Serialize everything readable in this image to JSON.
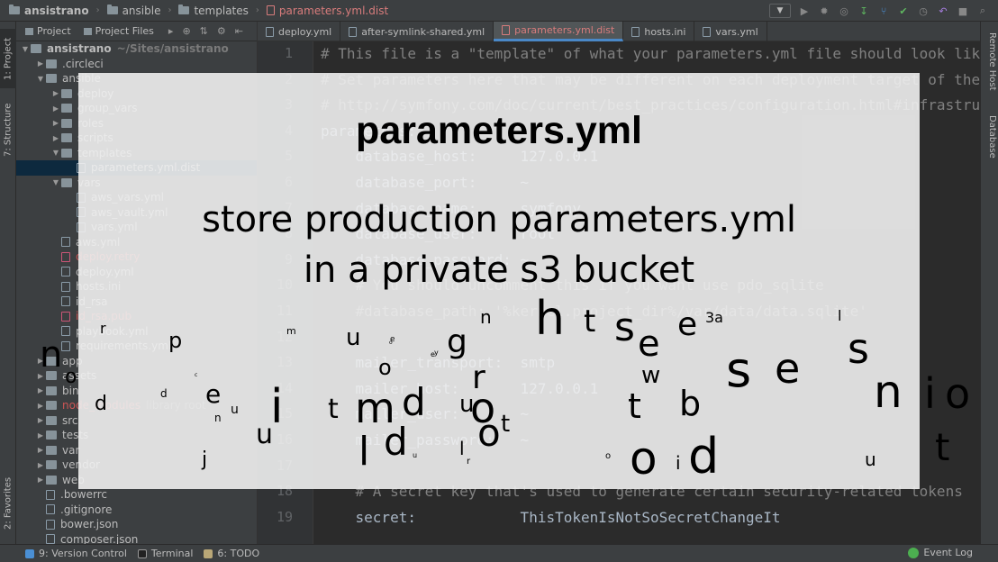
{
  "navbar": {
    "crumbs": [
      {
        "label": "ansistrano",
        "kind": "folder"
      },
      {
        "label": "ansible",
        "kind": "folder"
      },
      {
        "label": "templates",
        "kind": "folder"
      },
      {
        "label": "parameters.yml.dist",
        "kind": "file"
      }
    ]
  },
  "stripes": {
    "left": {
      "project": "1: Project",
      "structure": "7: Structure",
      "favorites": "2: Favorites"
    },
    "right": {
      "remote_host": "Remote Host",
      "database": "Database"
    }
  },
  "project_panel": {
    "tab_project": "Project",
    "tab_files": "Project Files",
    "tree": [
      {
        "label": "ansistrano",
        "note": "~/Sites/ansistrano",
        "depth": 0,
        "kind": "folder",
        "arrow": "▼",
        "bold": true
      },
      {
        "label": ".circleci",
        "depth": 1,
        "kind": "folder",
        "arrow": "▶"
      },
      {
        "label": "ansible",
        "depth": 1,
        "kind": "folder",
        "arrow": "▼"
      },
      {
        "label": "deploy",
        "depth": 2,
        "kind": "folder",
        "arrow": "▶"
      },
      {
        "label": "group_vars",
        "depth": 2,
        "kind": "folder",
        "arrow": "▶"
      },
      {
        "label": "roles",
        "depth": 2,
        "kind": "folder",
        "arrow": "▶"
      },
      {
        "label": "scripts",
        "depth": 2,
        "kind": "folder",
        "arrow": "▶"
      },
      {
        "label": "templates",
        "depth": 2,
        "kind": "folder",
        "arrow": "▼"
      },
      {
        "label": "parameters.yml.dist",
        "depth": 3,
        "kind": "file",
        "selected": true
      },
      {
        "label": "vars",
        "depth": 2,
        "kind": "folder",
        "arrow": "▼"
      },
      {
        "label": "aws_vars.yml",
        "depth": 3,
        "kind": "file"
      },
      {
        "label": "aws_vault.yml",
        "depth": 3,
        "kind": "file"
      },
      {
        "label": "vars.yml",
        "depth": 3,
        "kind": "file"
      },
      {
        "label": "aws.yml",
        "depth": 2,
        "kind": "file"
      },
      {
        "label": "deploy.retry",
        "depth": 2,
        "kind": "file",
        "red": true
      },
      {
        "label": "deploy.yml",
        "depth": 2,
        "kind": "file"
      },
      {
        "label": "hosts.ini",
        "depth": 2,
        "kind": "file"
      },
      {
        "label": "id_rsa",
        "depth": 2,
        "kind": "file"
      },
      {
        "label": "id_rsa.pub",
        "depth": 2,
        "kind": "file",
        "red": true
      },
      {
        "label": "playbook.yml",
        "depth": 2,
        "kind": "file"
      },
      {
        "label": "requirements.yml",
        "depth": 2,
        "kind": "file"
      },
      {
        "label": "app",
        "depth": 1,
        "kind": "folder",
        "arrow": "▶"
      },
      {
        "label": "assets",
        "depth": 1,
        "kind": "folder",
        "arrow": "▶"
      },
      {
        "label": "bin",
        "depth": 1,
        "kind": "folder",
        "arrow": "▶"
      },
      {
        "label": "node_modules",
        "note": "library root",
        "depth": 1,
        "kind": "folder",
        "arrow": "▶",
        "red": true
      },
      {
        "label": "src",
        "depth": 1,
        "kind": "folder",
        "arrow": "▶"
      },
      {
        "label": "tests",
        "depth": 1,
        "kind": "folder",
        "arrow": "▶"
      },
      {
        "label": "var",
        "depth": 1,
        "kind": "folder",
        "arrow": "▶"
      },
      {
        "label": "vendor",
        "depth": 1,
        "kind": "folder",
        "arrow": "▶"
      },
      {
        "label": "web",
        "depth": 1,
        "kind": "folder",
        "arrow": "▶"
      },
      {
        "label": ".bowerrc",
        "depth": 1,
        "kind": "file"
      },
      {
        "label": ".gitignore",
        "depth": 1,
        "kind": "file"
      },
      {
        "label": "bower.json",
        "depth": 1,
        "kind": "file"
      },
      {
        "label": "composer.json",
        "depth": 1,
        "kind": "file"
      }
    ]
  },
  "editor": {
    "tabs": [
      {
        "label": "deploy.yml",
        "active": false
      },
      {
        "label": "after-symlink-shared.yml",
        "active": false
      },
      {
        "label": "parameters.yml.dist",
        "active": true
      },
      {
        "label": "hosts.ini",
        "active": false
      },
      {
        "label": "vars.yml",
        "active": false
      }
    ],
    "lines": [
      {
        "n": "1",
        "text": "# This file is a \"template\" of what your parameters.yml file should look like",
        "comment": true
      },
      {
        "n": "2",
        "text": "# Set parameters here that may be different on each deployment target of the app",
        "comment": true
      },
      {
        "n": "3",
        "text": "# http://symfony.com/doc/current/best_practices/configuration.html#infrastructure",
        "comment": true
      },
      {
        "n": "4",
        "text": "parameters:",
        "comment": false
      },
      {
        "n": "5",
        "text": "    database_host:     127.0.0.1",
        "comment": false
      },
      {
        "n": "6",
        "text": "    database_port:     ~",
        "comment": false
      },
      {
        "n": "7",
        "text": "    database_name:     symfony",
        "comment": false
      },
      {
        "n": "8",
        "text": "    database_user:     root",
        "comment": false
      },
      {
        "n": "9",
        "text": "    database_password: ~",
        "comment": false
      },
      {
        "n": "10",
        "text": "    # You should uncomment this if you want use pdo_sqlite",
        "comment": true
      },
      {
        "n": "11",
        "text": "    #database_path: '%kernel.project_dir%/var/data/data.sqlite'",
        "comment": true
      },
      {
        "n": "12",
        "text": "",
        "comment": false
      },
      {
        "n": "13",
        "text": "    mailer_transport:  smtp",
        "comment": false
      },
      {
        "n": "14",
        "text": "    mailer_host:       127.0.0.1",
        "comment": false
      },
      {
        "n": "15",
        "text": "    mailer_user:       ~",
        "comment": false
      },
      {
        "n": "16",
        "text": "    mailer_password:   ~",
        "comment": false
      },
      {
        "n": "17",
        "text": "",
        "comment": false
      },
      {
        "n": "18",
        "text": "    # A secret key that's used to generate certain security-related tokens",
        "comment": true
      },
      {
        "n": "19",
        "text": "    secret:            ThisTokenIsNotSoSecretChangeIt",
        "comment": false
      }
    ]
  },
  "statusbar": {
    "version_control": "9: Version Control",
    "terminal": "Terminal",
    "todo": "6: TODO",
    "event_log": "Event Log"
  },
  "overlay": {
    "title": "parameters.yml",
    "line1": "store production parameters.yml",
    "line2": "in a private s3 bucket",
    "letters": [
      "r",
      "p",
      "m",
      "u",
      "e",
      "g",
      "n",
      "h",
      "t",
      "s",
      "e",
      "e",
      "3a",
      "l",
      "s",
      "s",
      "e",
      "n",
      "i",
      "o",
      "n",
      "o",
      "d",
      "o",
      "r",
      "w",
      "e",
      "d",
      "i",
      "t",
      "m",
      "d",
      "u",
      "o",
      "u",
      "t",
      "b",
      "n",
      "u",
      "l",
      "d",
      "l",
      "o",
      "t",
      "r",
      "o",
      "d",
      "o",
      "t",
      "i",
      "j",
      "y",
      "u",
      "o",
      "c",
      "e",
      "u"
    ]
  },
  "colors": {
    "comment": "#808080",
    "code": "#a9b7c6",
    "active_tab": "#d87c7c",
    "selection": "#0d293e",
    "overlay_bg": "#f0f0f0"
  }
}
